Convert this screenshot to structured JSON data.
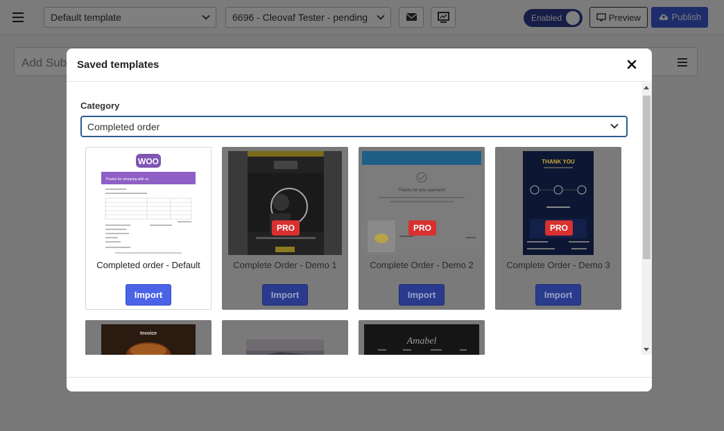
{
  "topbar": {
    "template_select": "Default template",
    "order_select": "6696 - Cleovaf Tester - pending",
    "toggle_label": "Enabled",
    "preview_label": "Preview",
    "publish_label": "Publish"
  },
  "subject": {
    "placeholder": "Add Sub"
  },
  "modal": {
    "title": "Saved templates",
    "category_label": "Category",
    "category_value": "Completed order",
    "templates": [
      {
        "name": "Completed order - Default",
        "import_label": "Import",
        "pro": false
      },
      {
        "name": "Complete Order - Demo 1",
        "import_label": "Import",
        "pro": true,
        "badge": "PRO"
      },
      {
        "name": "Complete Order - Demo 2",
        "import_label": "Import",
        "pro": true,
        "badge": "PRO"
      },
      {
        "name": "Complete Order - Demo 3",
        "import_label": "Import",
        "pro": true,
        "badge": "PRO"
      }
    ],
    "thumb_text": {
      "woo": "WOO",
      "woo_banner": "Thanks for shopping with us",
      "demo2_heading": "Thanks for your payment!",
      "demo3_heading": "THANK YOU",
      "row2_invoice": "Invoice",
      "row2_amabel": "Amabel"
    }
  },
  "colors": {
    "accent": "#4b63e6",
    "pro_badge": "#d93030",
    "toggle": "#2c3d8f",
    "woo_purple": "#7f54b3"
  }
}
